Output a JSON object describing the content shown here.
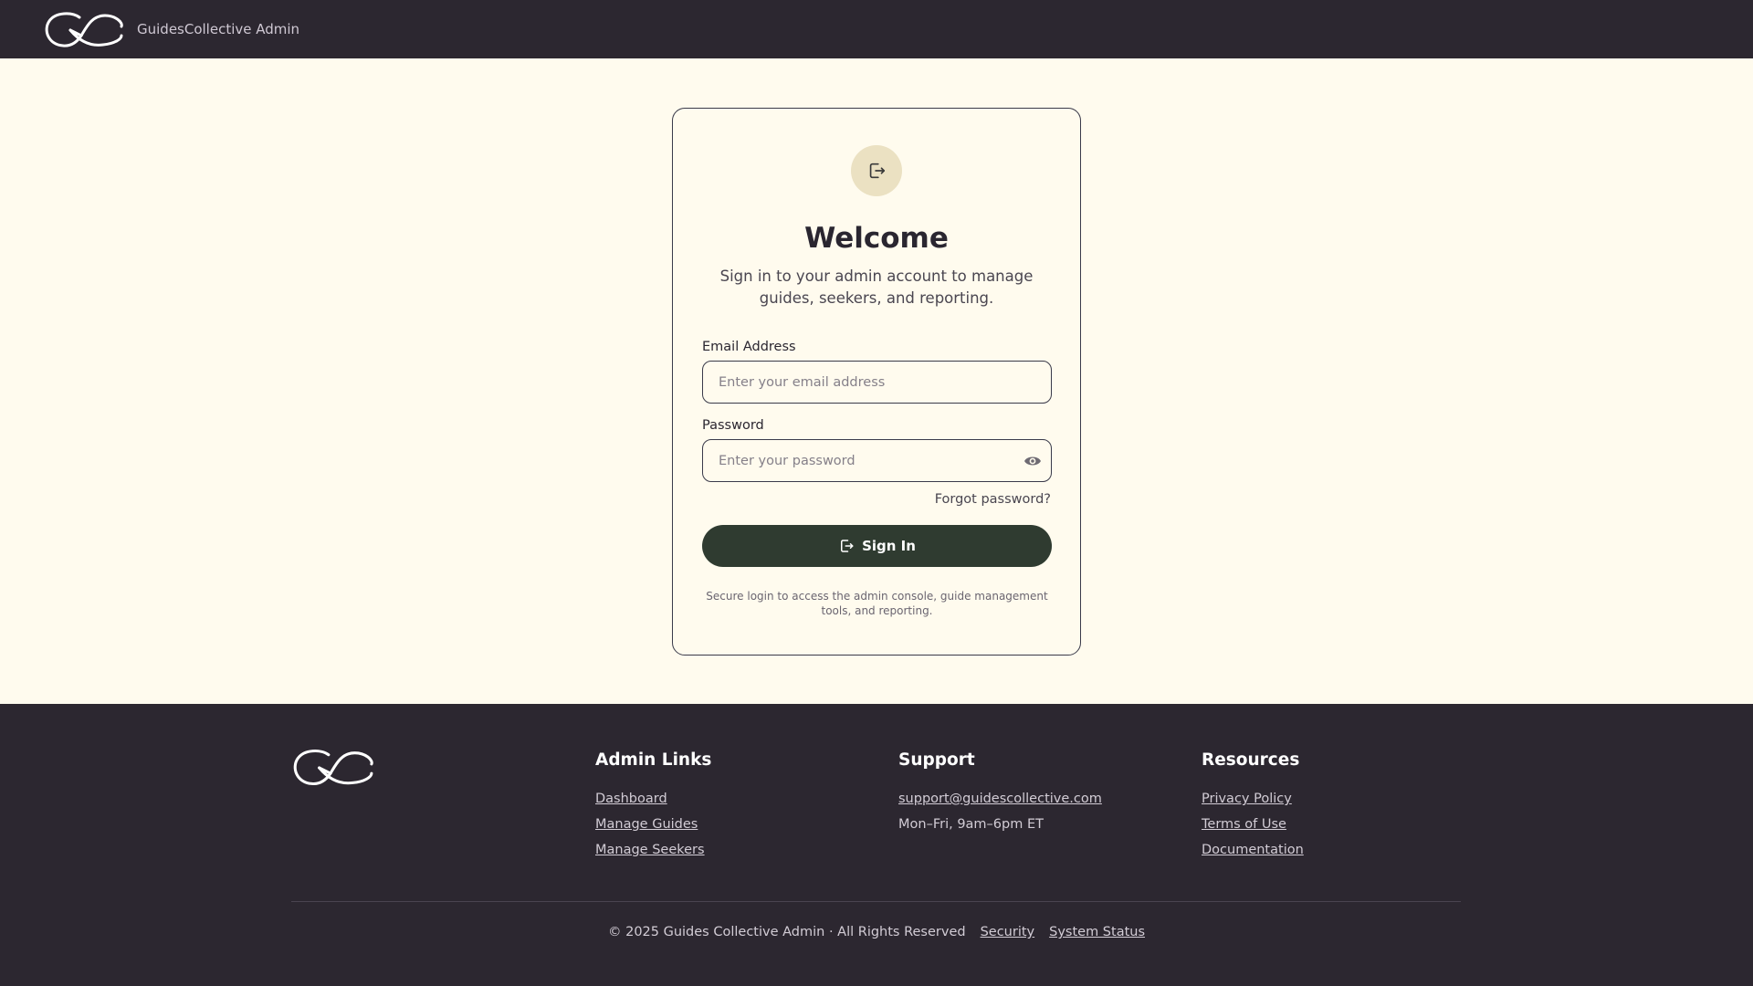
{
  "header": {
    "brand": "GuidesCollective Admin",
    "logo_icon": "gc-logo-icon"
  },
  "login": {
    "icon": "sign-in-icon",
    "title": "Welcome",
    "subtitle": "Sign in to your admin account to manage guides, seekers, and reporting.",
    "email_label": "Email Address",
    "email_placeholder": "Enter your email address",
    "email_value": "",
    "password_label": "Password",
    "password_placeholder": "Enter your password",
    "password_value": "",
    "forgot": "Forgot password?",
    "signin_label": "Sign In",
    "note": "Secure login to access the admin console, guide management tools, and reporting."
  },
  "footer": {
    "columns": [
      {
        "heading": "Admin Links",
        "items": [
          "Dashboard",
          "Manage Guides",
          "Manage Seekers"
        ]
      },
      {
        "heading": "Support",
        "items": [
          "support@guidescollective.com",
          "Mon–Fri, 9am–6pm ET"
        ]
      },
      {
        "heading": "Resources",
        "items": [
          "Privacy Policy",
          "Terms of Use",
          "Documentation"
        ]
      }
    ],
    "copyright": "© 2025 Guides Collective Admin · All Rights Reserved",
    "security": "Security",
    "status": "System Status"
  },
  "colors": {
    "header_bg": "#2c2730",
    "page_bg": "#fffbee",
    "button_bg": "#2f3b30",
    "icon_circle": "#ebe1c2"
  }
}
